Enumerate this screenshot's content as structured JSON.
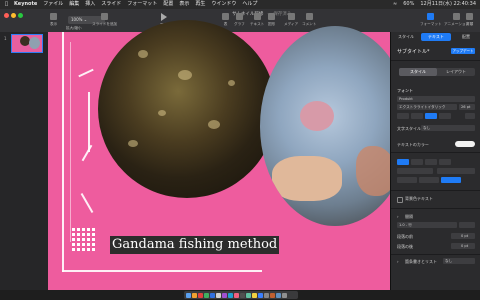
{
  "menubar": {
    "app": "Keynote",
    "items": [
      "ファイル",
      "編集",
      "挿入",
      "スライド",
      "フォーマット",
      "配置",
      "表示",
      "再生",
      "ウインドウ",
      "ヘルプ"
    ],
    "battery": "60%",
    "datetime": "12月11日(水) 22:40:34"
  },
  "toolbar": {
    "zoom_value": "100%",
    "left_labels": [
      "表示",
      "拡大/縮小",
      "スライドを追加"
    ],
    "play_label": "再生",
    "insert_labels": [
      "表",
      "グラフ",
      "テキスト",
      "図形",
      "メディア",
      "コメント"
    ],
    "right_labels": [
      "フォーマット",
      "アニメーション",
      "書類"
    ],
    "window_title": "サムネイル研修",
    "window_subtitle": "— 保存済み"
  },
  "navigator": {
    "slide_number": "1"
  },
  "slide": {
    "title": "Gandama fishing method"
  },
  "inspector": {
    "tabs": [
      "スタイル",
      "テキスト",
      "配置"
    ],
    "active_tab": "テキスト",
    "paragraph_style": "サブタイトル*",
    "update_button": "アップデート",
    "segments": [
      "スタイル",
      "レイアウト"
    ],
    "font_header": "フォント",
    "font_name": "Produkt",
    "font_weight": "エクストラライトイタリック",
    "font_size": "26 pt",
    "char_style_label": "文字スタイル",
    "char_style_value": "なし",
    "text_color_label": "テキストのカラー",
    "alignment_label": "",
    "bullets_label": "箇条書きとリスト",
    "bullets_value": "なし",
    "spacing_label": "間隔",
    "spacing_value": "1.0 - 行",
    "before_label": "段落の前",
    "before_value": "0 pt",
    "after_label": "段落の後",
    "after_value": "0 pt",
    "shadow_label": "背景塗りつぶし",
    "check_label": "背景色テキスト"
  }
}
